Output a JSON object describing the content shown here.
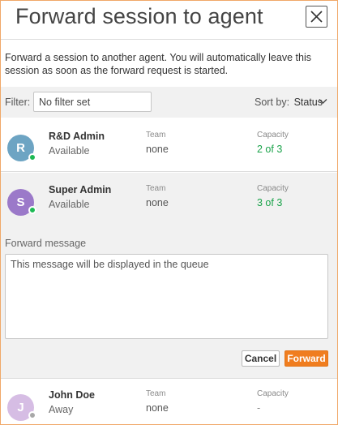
{
  "dialog": {
    "title": "Forward session to agent",
    "close_icon": "close-icon",
    "intro": "Forward a session to another agent. You will automatically leave this session as soon as the forward request is started."
  },
  "filter": {
    "label": "Filter:",
    "placeholder": "No filter set",
    "value": ""
  },
  "sort": {
    "label": "Sort by:",
    "value": "Status",
    "icon": "chevron-down-icon"
  },
  "agents": [
    {
      "initial": "R",
      "name": "R&D Admin",
      "status": "Available",
      "team_label": "Team",
      "team": "none",
      "capacity_label": "Capacity",
      "capacity": "2 of 3",
      "avatar_color": "#6da4c3",
      "status_color": "#1db954"
    },
    {
      "initial": "S",
      "name": "Super Admin",
      "status": "Available",
      "team_label": "Team",
      "team": "none",
      "capacity_label": "Capacity",
      "capacity": "3 of 3",
      "avatar_color": "#9b79c9",
      "status_color": "#1db954"
    },
    {
      "initial": "J",
      "name": "John Doe",
      "status": "Away",
      "team_label": "Team",
      "team": "none",
      "capacity_label": "Capacity",
      "capacity": "-",
      "avatar_color": "#d6bde4",
      "status_color": "#a8a8a8"
    }
  ],
  "forward_message": {
    "label": "Forward message",
    "placeholder": "This message will be displayed in the queue",
    "value": "",
    "cancel_label": "Cancel",
    "forward_label": "Forward"
  },
  "colors": {
    "accent": "#f07d1f",
    "available": "#1db954",
    "capacity_green": "#1aa34a"
  }
}
